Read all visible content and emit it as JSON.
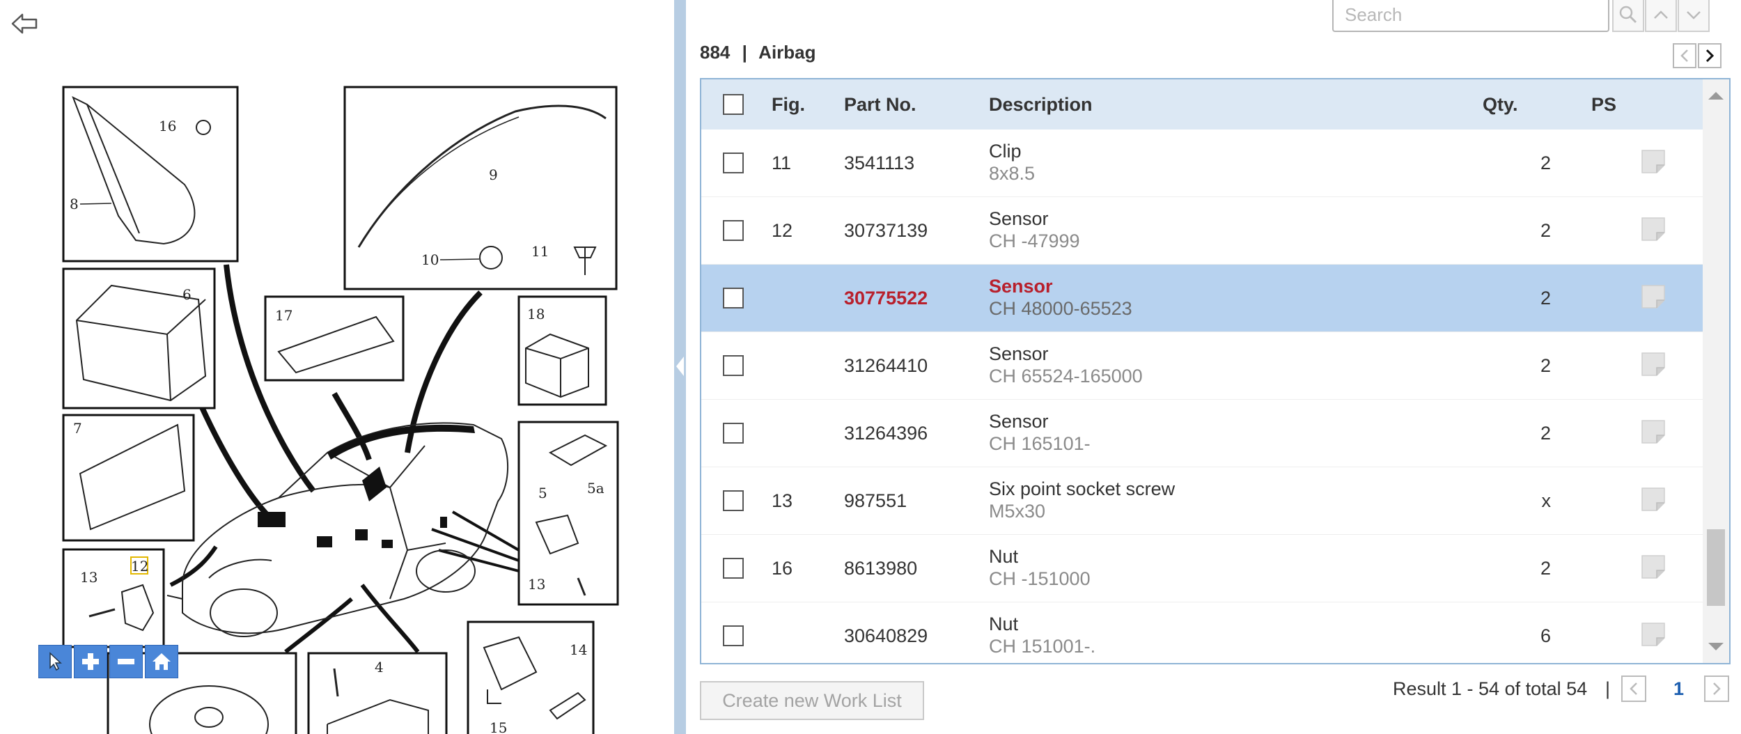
{
  "search": {
    "placeholder": "Search"
  },
  "page": {
    "section_no": "884",
    "separator": "|",
    "section_name": "Airbag"
  },
  "table": {
    "columns": {
      "fig": "Fig.",
      "part_no": "Part No.",
      "description": "Description",
      "qty": "Qty.",
      "ps": "PS"
    },
    "rows": [
      {
        "fig": "11",
        "part_no": "3541113",
        "description": "Clip",
        "detail": "8x8.5",
        "qty": "2"
      },
      {
        "fig": "12",
        "part_no": "30737139",
        "description": "Sensor",
        "detail": "CH -47999",
        "qty": "2"
      },
      {
        "fig": "",
        "part_no": "30775522",
        "description": "Sensor",
        "detail": "CH 48000-65523",
        "qty": "2",
        "selected": true
      },
      {
        "fig": "",
        "part_no": "31264410",
        "description": "Sensor",
        "detail": "CH 65524-165000",
        "qty": "2"
      },
      {
        "fig": "",
        "part_no": "31264396",
        "description": "Sensor",
        "detail": "CH 165101-",
        "qty": "2"
      },
      {
        "fig": "13",
        "part_no": "987551",
        "description": "Six point socket screw",
        "detail": "M5x30",
        "qty": "x"
      },
      {
        "fig": "16",
        "part_no": "8613980",
        "description": "Nut",
        "detail": "CH -151000",
        "qty": "2"
      },
      {
        "fig": "",
        "part_no": "30640829",
        "description": "Nut",
        "detail": "CH 151001-.",
        "qty": "6"
      }
    ]
  },
  "footer": {
    "create_worklist": "Create new Work List",
    "result": "Result 1 - 54 of total 54",
    "separator": "|",
    "current_page": "1"
  },
  "diagram": {
    "labels": [
      "16",
      "8",
      "6",
      "7",
      "13",
      "12",
      "9",
      "10",
      "11",
      "17",
      "18",
      "5",
      "5a",
      "13",
      "4",
      "14",
      "15"
    ]
  },
  "colors": {
    "selected_row": "#b7d2ef",
    "header": "#dce8f4",
    "accent_text": "#b8202c",
    "tool_blue": "#4a86d8"
  },
  "icons": [
    "back-arrow-icon",
    "search-icon",
    "chevron-up-icon",
    "chevron-down-icon",
    "chevron-left-icon",
    "chevron-right-icon",
    "note-icon",
    "pointer-icon",
    "zoom-in-icon",
    "zoom-out-icon",
    "home-icon"
  ]
}
